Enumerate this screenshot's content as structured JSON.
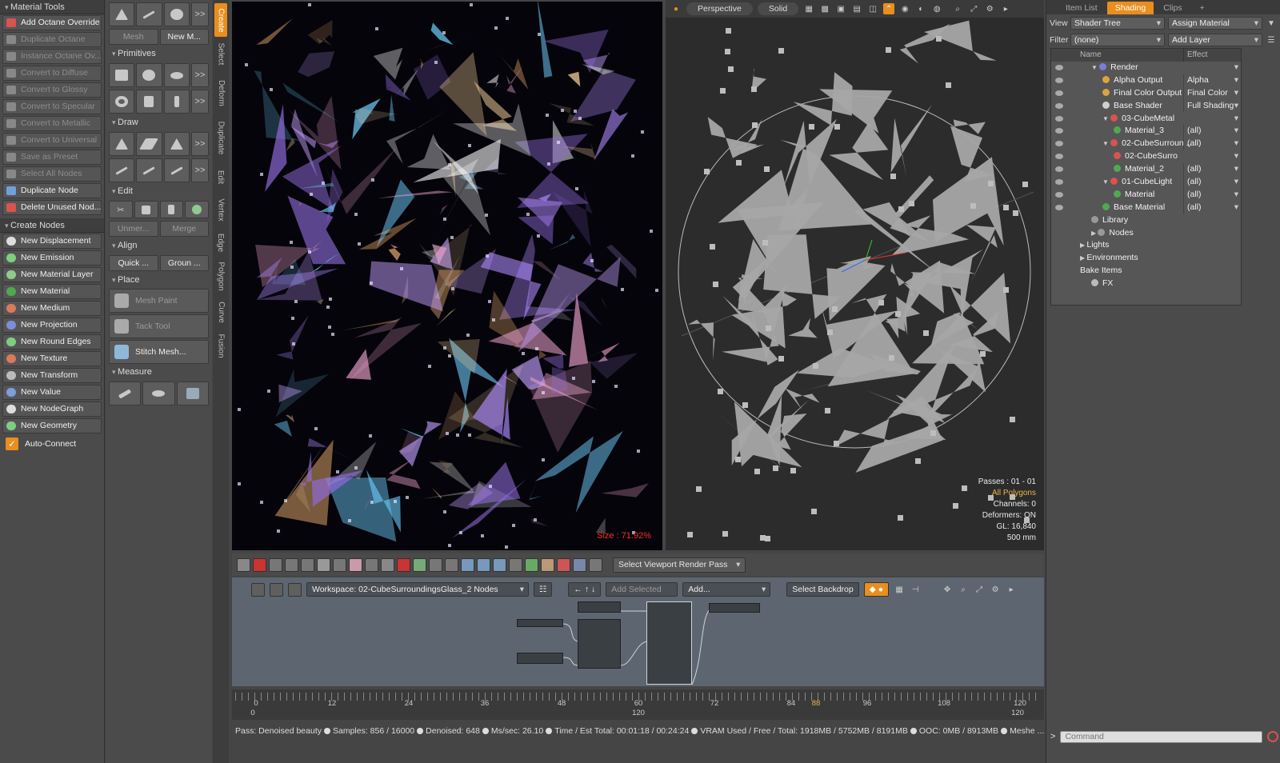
{
  "material_tools": {
    "title": "Material Tools",
    "buttons": [
      {
        "label": "Add Octane Override",
        "enabled": true,
        "color": "#d9534f"
      },
      {
        "label": "Duplicate Octane",
        "enabled": false,
        "color": "#888888"
      },
      {
        "label": "Instance Octane Ov...",
        "enabled": false,
        "color": "#888888"
      },
      {
        "label": "Convert to Diffuse",
        "enabled": false,
        "color": "#888888"
      },
      {
        "label": "Convert to Glossy",
        "enabled": false,
        "color": "#888888"
      },
      {
        "label": "Convert to Specular",
        "enabled": false,
        "color": "#888888"
      },
      {
        "label": "Convert to Metallic",
        "enabled": false,
        "color": "#888888"
      },
      {
        "label": "Convert to Universal",
        "enabled": false,
        "color": "#888888"
      },
      {
        "label": "Save as Preset",
        "enabled": false,
        "color": "#888888"
      },
      {
        "label": "Select All Nodes",
        "enabled": false,
        "color": "#888888"
      },
      {
        "label": "Duplicate Node",
        "enabled": true,
        "color": "#6fa0d8"
      },
      {
        "label": "Delete Unused Nod...",
        "enabled": true,
        "color": "#d9534f"
      }
    ],
    "create_title": "Create Nodes",
    "create_buttons": [
      {
        "label": "New Displacement",
        "color": "#dddddd"
      },
      {
        "label": "New Emission",
        "color": "#7dcf7d"
      },
      {
        "label": "New Material Layer",
        "color": "#8fc98f"
      },
      {
        "label": "New Material",
        "color": "#4faa4f"
      },
      {
        "label": "New Medium",
        "color": "#d97a5a"
      },
      {
        "label": "New Projection",
        "color": "#7a8fd9"
      },
      {
        "label": "New Round Edges",
        "color": "#7dcf7d"
      },
      {
        "label": "New Texture",
        "color": "#d97a5a"
      },
      {
        "label": "New Transform",
        "color": "#bbbbbb"
      },
      {
        "label": "New Value",
        "color": "#7a9fd9"
      },
      {
        "label": "New NodeGraph",
        "color": "#dddddd"
      },
      {
        "label": "New Geometry",
        "color": "#7dcf7d"
      }
    ],
    "auto_connect": "Auto-Connect"
  },
  "tool_palette": {
    "mesh_label": "Mesh",
    "new_mesh_label": "New M...",
    "more_label": ">>",
    "primitives": "Primitives",
    "draw": "Draw",
    "edit": "Edit",
    "unmerge": "Unmer...",
    "merge": "Merge",
    "align": "Align",
    "quick": "Quick ...",
    "ground": "Groun ...",
    "place": "Place",
    "mesh_paint": "Mesh Paint",
    "tack_tool": "Tack Tool",
    "stitch_mesh": "Stitch Mesh...",
    "measure": "Measure"
  },
  "vertical_tabs": [
    "Create",
    "Select",
    "Deform",
    "Duplicate",
    "Edit",
    "Vertex",
    "Edge",
    "Polygon",
    "Curve",
    "Fusion"
  ],
  "render_view": {
    "size_label": "Size : 71.92%"
  },
  "viewport": {
    "projection": "Perspective",
    "shading": "Solid",
    "info": {
      "passes": "Passes : 01 - 01",
      "selection": "All Polygons",
      "channels": "Channels: 0",
      "deformers": "Deformers: ON",
      "gl": "GL: 16,840",
      "scale": "500 mm"
    }
  },
  "shading_panel": {
    "tabs": [
      "Item List",
      "Shading",
      "Clips",
      "+"
    ],
    "active_tab": 1,
    "view_label": "View",
    "view_value": "Shader Tree",
    "assign_label": "Assign Material",
    "filter_label": "Filter",
    "filter_value": "(none)",
    "add_layer": "Add Layer",
    "col_name": "Name",
    "col_effect": "Effect",
    "tree": [
      {
        "name": "Render",
        "effect": "",
        "indent": 1,
        "color": "#7c7cd9",
        "expander": "▼"
      },
      {
        "name": "Alpha Output",
        "effect": "Alpha",
        "indent": 2,
        "color": "#d9a441",
        "expander": ""
      },
      {
        "name": "Final Color Output",
        "effect": "Final Color",
        "indent": 2,
        "color": "#d9a441",
        "expander": ""
      },
      {
        "name": "Base Shader",
        "effect": "Full Shading",
        "indent": 2,
        "color": "#cfcfcf",
        "expander": ""
      },
      {
        "name": "03-CubeMetal",
        "effect": "",
        "indent": 2,
        "color": "#d9534f",
        "expander": "▼"
      },
      {
        "name": "Material_3",
        "effect": "(all)",
        "indent": 3,
        "color": "#4faa4f",
        "expander": ""
      },
      {
        "name": "02-CubeSurroun ...",
        "effect": "(all)",
        "indent": 2,
        "color": "#d9534f",
        "expander": "▼"
      },
      {
        "name": "02-CubeSurro",
        "effect": "",
        "indent": 3,
        "color": "#d9534f",
        "expander": ""
      },
      {
        "name": "Material_2",
        "effect": "(all)",
        "indent": 3,
        "color": "#4faa4f",
        "expander": ""
      },
      {
        "name": "01-CubeLight",
        "effect": "(all)",
        "indent": 2,
        "color": "#d9534f",
        "expander": "▼"
      },
      {
        "name": "Material",
        "effect": "(all)",
        "indent": 3,
        "color": "#4faa4f",
        "expander": ""
      },
      {
        "name": "Base Material",
        "effect": "(all)",
        "indent": 2,
        "color": "#4faa4f",
        "expander": ""
      },
      {
        "name": "Library",
        "effect": "",
        "indent": 1,
        "color": "#999999",
        "expander": ""
      },
      {
        "name": "Nodes",
        "effect": "",
        "indent": 1,
        "color": "#999999",
        "expander": "▶"
      },
      {
        "name": "Lights",
        "effect": "",
        "indent": 0,
        "color": "",
        "expander": "▶"
      },
      {
        "name": "Environments",
        "effect": "",
        "indent": 0,
        "color": "",
        "expander": "▶"
      },
      {
        "name": "Bake Items",
        "effect": "",
        "indent": 0,
        "color": "",
        "expander": ""
      },
      {
        "name": "FX",
        "effect": "",
        "indent": 1,
        "color": "#bbbbbb",
        "expander": ""
      }
    ],
    "command_placeholder": "Command",
    "command_prompt": ">"
  },
  "bottom_toolbar": {
    "render_pass": "Select Viewport Render Pass"
  },
  "node_editor": {
    "workspace": "Workspace: 02-CubeSurroundingsGlass_2 Nodes",
    "add_selected": "Add Selected",
    "add": "Add...",
    "backdrop": "Select Backdrop"
  },
  "timeline": {
    "ticks": [
      "0",
      "12",
      "24",
      "36",
      "48",
      "60",
      "72",
      "84",
      "88",
      "96",
      "108",
      "120"
    ],
    "current": "88",
    "start": "0",
    "end_mid": "120",
    "end": "120"
  },
  "status": {
    "items": [
      "Pass: Denoised beauty",
      "Samples: 856  / 16000",
      "Denoised: 648",
      "Ms/sec: 26.10",
      "Time / Est Total: 00:01:18 / 00:24:24",
      "VRAM Used / Free / Total: 1918MB / 5752MB / 8191MB",
      "OOC: 0MB / 8913MB",
      "Meshe ..."
    ]
  }
}
